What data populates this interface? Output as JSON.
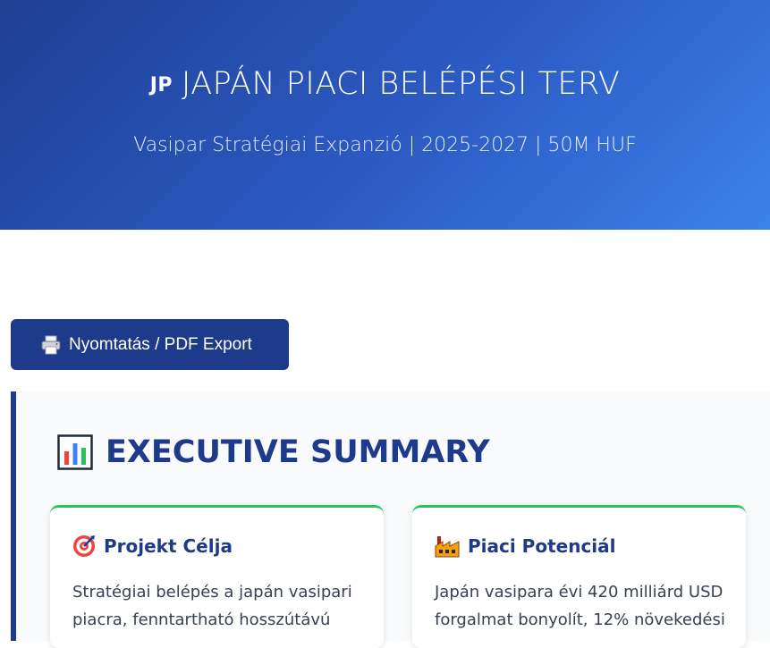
{
  "header": {
    "flag": "JP",
    "title": "JAPÁN PIACI BELÉPÉSI TERV",
    "subtitle": "Vasipar Stratégiai Expanzió | 2025-2027 | 50M HUF"
  },
  "toolbar": {
    "print_icon": "printer-icon",
    "print_label": "Nyomtatás / PDF Export"
  },
  "summary": {
    "icon": "bar-chart-icon",
    "title": "EXECUTIVE SUMMARY",
    "cards": [
      {
        "icon": "target-icon",
        "title": "Projekt Célja",
        "text": "Stratégiai belépés a japán vasipari piacra, fenntartható hosszútávú"
      },
      {
        "icon": "factory-icon",
        "title": "Piaci Potenciál",
        "text": "Japán vasipara évi 420 milliárd USD forgalmat bonyolít, 12% növekedési"
      }
    ]
  },
  "colors": {
    "brand": "#1e3a8a",
    "hero_gradient_start": "#1f3f93",
    "hero_gradient_end": "#3b82ea",
    "card_accent": "#22c55e"
  }
}
